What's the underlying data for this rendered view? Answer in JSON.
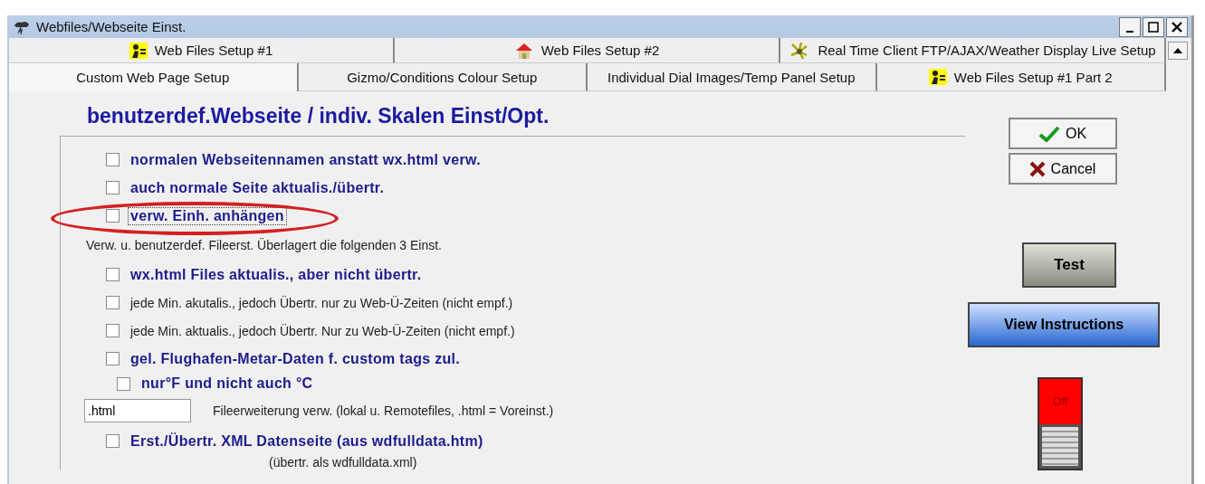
{
  "window": {
    "title": "Webfiles/Webseite Einst."
  },
  "tab_rows": [
    {
      "tabs": [
        {
          "label": "Web Files Setup #1",
          "selected": false
        },
        {
          "label": "Web Files Setup #2",
          "selected": false
        },
        {
          "label": "Real Time Client FTP/AJAX/Weather Display Live Setup",
          "selected": false
        }
      ]
    },
    {
      "tabs": [
        {
          "label": "Custom Web Page Setup",
          "selected": true
        },
        {
          "label": "Gizmo/Conditions Colour Setup",
          "selected": false
        },
        {
          "label": "Individual Dial Images/Temp Panel Setup",
          "selected": false
        },
        {
          "label": "Web Files Setup #1 Part 2",
          "selected": false
        }
      ]
    }
  ],
  "heading": "benutzerdef.Webseite / indiv. Skalen Einst/Opt.",
  "options": [
    {
      "kind": "check",
      "label": "normalen Webseitennamen anstatt wx.html verw.",
      "bold": true,
      "checked": false,
      "focused": false
    },
    {
      "kind": "check",
      "label": "auch normale Seite aktualis./übertr.",
      "bold": true,
      "checked": false,
      "focused": false
    },
    {
      "kind": "check",
      "label": "verw. Einh. anhängen",
      "bold": true,
      "checked": false,
      "focused": true
    },
    {
      "kind": "note",
      "label": "Verw. u. benutzerdef. Fileerst. Überlagert die folgenden 3 Einst."
    },
    {
      "kind": "check",
      "label": "wx.html Files aktualis., aber nicht übertr.",
      "bold": true,
      "checked": false,
      "focused": false
    },
    {
      "kind": "check",
      "label": "jede Min. akutalis., jedoch Übertr. nur zu Web-Ü-Zeiten (nicht empf.)",
      "bold": false,
      "checked": false,
      "focused": false
    },
    {
      "kind": "check",
      "label": "jede Min. aktualis., jedoch Übertr. Nur zu Web-Ü-Zeiten (nicht empf.)",
      "bold": false,
      "checked": false,
      "focused": false
    },
    {
      "kind": "check",
      "label": "gel. Flughafen-Metar-Daten f. custom tags zul.",
      "bold": true,
      "checked": false,
      "focused": false,
      "children": [
        {
          "kind": "check",
          "label": "nur°F und nicht auch °C",
          "bold": true,
          "checked": false,
          "focused": false
        }
      ]
    },
    {
      "kind": "input",
      "value": ".html",
      "label": "Fileerweiterung verw. (lokal u. Remotefiles,  .html = Voreinst.)"
    },
    {
      "kind": "check",
      "label": "Erst./Übertr. XML Datenseite (aus wdfulldata.htm)",
      "bold": true,
      "checked": false,
      "focused": false,
      "note": "(übertr. als wdfulldata.xml)"
    }
  ],
  "buttons": {
    "ok": "OK",
    "cancel": "Cancel",
    "test": "Test",
    "instructions": "View Instructions"
  },
  "switch": {
    "label": "Off",
    "on": false
  },
  "annotation": {
    "kind": "ellipse",
    "color": "#d42020"
  }
}
